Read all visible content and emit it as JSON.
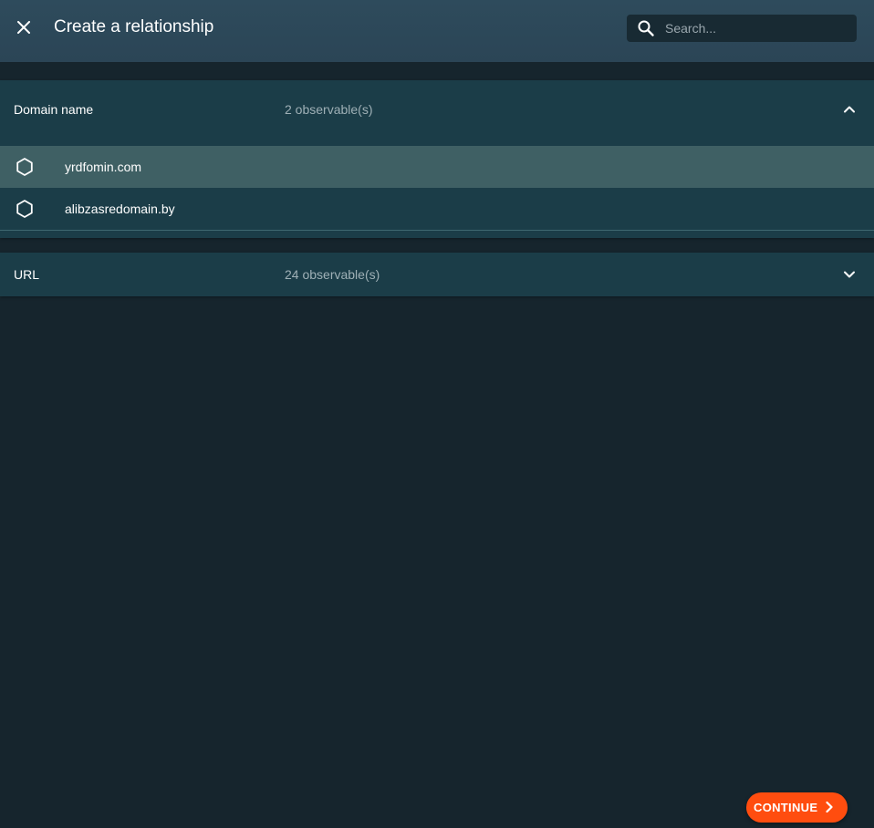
{
  "header": {
    "title": "Create a relationship",
    "close_icon": "close-icon",
    "search": {
      "placeholder": "Search...",
      "value": "",
      "icon": "search-icon"
    }
  },
  "groups": [
    {
      "label": "Domain name",
      "count": "2 observable(s)",
      "expanded": true,
      "chevron_icon": "chevron-up-icon",
      "items": [
        {
          "value": "yrdfomin.com",
          "icon": "hexagon-icon",
          "highlighted": true
        },
        {
          "value": "alibzasredomain.by",
          "icon": "hexagon-icon",
          "highlighted": false
        }
      ]
    },
    {
      "label": "URL",
      "count": "24 observable(s)",
      "expanded": false,
      "chevron_icon": "chevron-down-icon"
    }
  ],
  "footer": {
    "continue_label": "CONTINUE",
    "continue_icon": "chevron-right-icon"
  },
  "colors": {
    "background": "#16252d",
    "header": "#2e4b5c",
    "panel": "#1b3d48",
    "highlight_row": "#3f6064",
    "accent": "#ff4d0f",
    "muted_text": "#9fb0b6"
  }
}
